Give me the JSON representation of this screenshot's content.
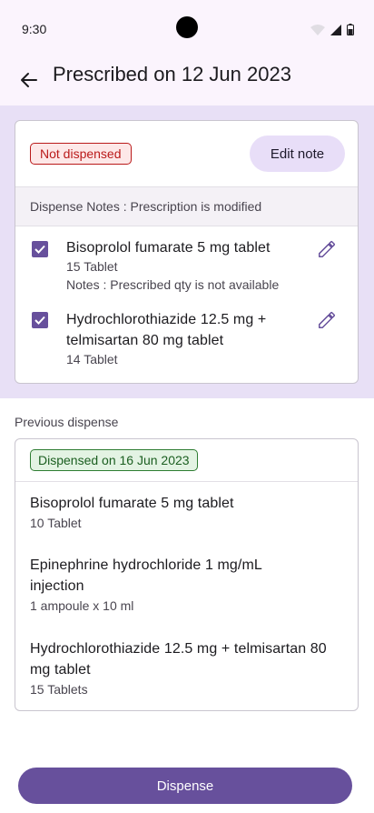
{
  "status_bar": {
    "time": "9:30"
  },
  "header": {
    "title": "Prescribed on 12 Jun 2023"
  },
  "current": {
    "status_chip": "Not dispensed",
    "edit_note_label": "Edit note",
    "dispense_notes": "Dispense Notes : Prescription is modified",
    "items": [
      {
        "name": "Bisoprolol fumarate 5 mg tablet",
        "qty": "15 Tablet",
        "notes": "Notes : Prescribed qty is not available",
        "checked": true
      },
      {
        "name": "Hydrochlorothiazide 12.5 mg + telmisartan 80 mg tablet",
        "qty": "14 Tablet",
        "checked": true
      }
    ]
  },
  "previous": {
    "section_label": "Previous dispense",
    "status_chip": "Dispensed on 16 Jun 2023",
    "items": [
      {
        "name": "Bisoprolol fumarate 5 mg tablet",
        "qty": "10 Tablet"
      },
      {
        "name": "Epinephrine hydrochloride 1 mg/mL injection",
        "qty": "1 ampoule x 10 ml"
      },
      {
        "name": "Hydrochlorothiazide 12.5 mg + telmisartan 80 mg tablet",
        "qty": "15 Tablets"
      }
    ]
  },
  "footer": {
    "dispense_label": "Dispense"
  },
  "colors": {
    "primary": "#67509c",
    "error": "#ba1a1a",
    "success": "#2e7d32",
    "section_bg": "#e8e0f6"
  },
  "icons": {
    "back": "arrow-back-icon",
    "edit": "pencil-icon",
    "check": "check-icon"
  }
}
